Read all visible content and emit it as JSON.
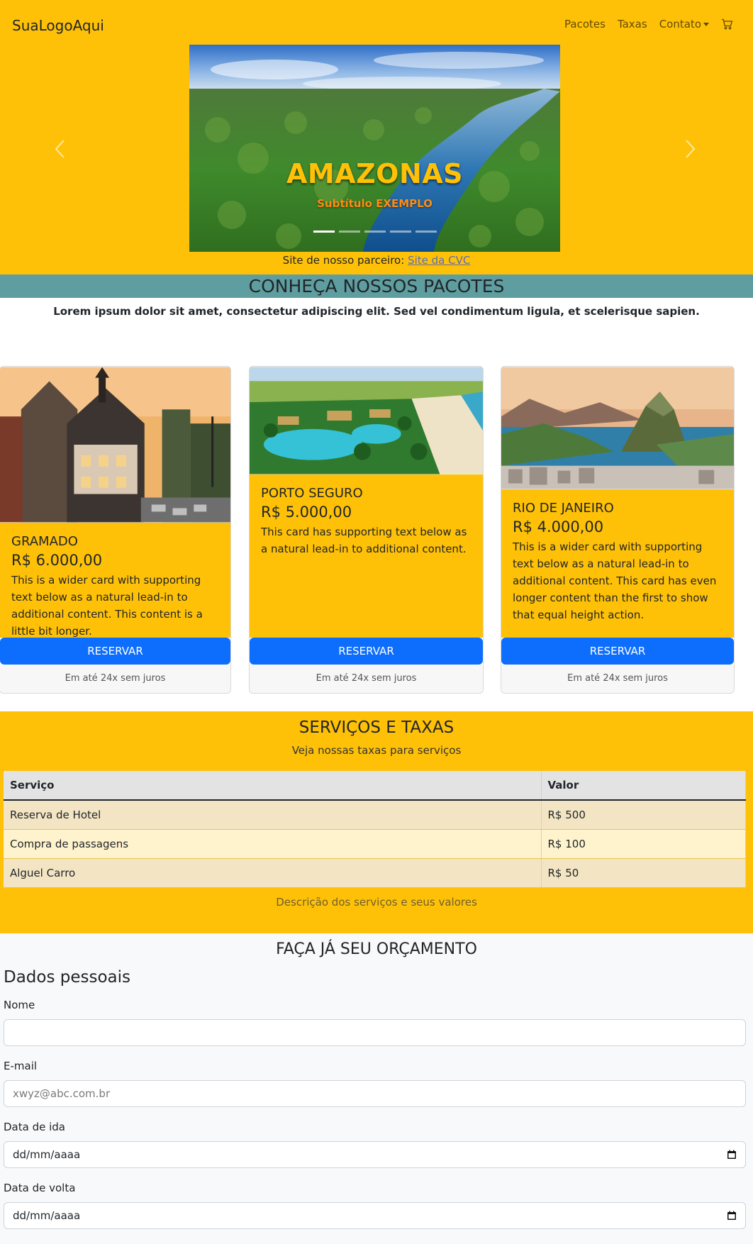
{
  "navbar": {
    "brand": "SuaLogoAqui",
    "links": [
      "Pacotes",
      "Taxas",
      "Contato"
    ],
    "cart_icon": "cart-icon"
  },
  "carousel": {
    "title": "AMAZONAS",
    "subtitle": "Subtítulo EXEMPLO",
    "indicator_count": 5,
    "active_index": 0,
    "prev_icon": "chevron-left-icon",
    "next_icon": "chevron-right-icon"
  },
  "partner": {
    "text": "Site de nosso parceiro: ",
    "link_label": "Site da CVC"
  },
  "packages": {
    "title": "CONHEÇA NOSSOS PACOTES",
    "lead": "Lorem ipsum dolor sit amet, consectetur adipiscing elit. Sed vel condimentum ligula, et scelerisque sapien.",
    "cards": [
      {
        "title": "GRAMADO",
        "price": "R$ 6.000,00",
        "text": "This is a wider card with supporting text below as a natural lead-in to additional content. This content is a little bit longer.",
        "button": "RESERVAR",
        "footer": "Em até 24x sem juros"
      },
      {
        "title": "PORTO SEGURO",
        "price": "R$ 5.000,00",
        "text": "This card has supporting text below as a natural lead-in to additional content.",
        "button": "RESERVAR",
        "footer": "Em até 24x sem juros"
      },
      {
        "title": "RIO DE JANEIRO",
        "price": "R$ 4.000,00",
        "text": "This is a wider card with supporting text below as a natural lead-in to additional content. This card has even longer content than the first to show that equal height action.",
        "button": "RESERVAR",
        "footer": "Em até 24x sem juros"
      }
    ]
  },
  "services": {
    "title": "SERVIÇOS E TAXAS",
    "subtitle": "Veja nossas taxas para serviços",
    "headers": [
      "Serviço",
      "Valor"
    ],
    "rows": [
      [
        "Reserva de Hotel",
        "R$ 500"
      ],
      [
        "Compra de passagens",
        "R$ 100"
      ],
      [
        "Alguel Carro",
        "R$ 50"
      ]
    ],
    "caption": "Descrição dos serviços e seus valores"
  },
  "quote": {
    "title": "FAÇA JÁ SEU ORÇAMENTO",
    "section": "Dados pessoais",
    "name_label": "Nome",
    "name_value": "",
    "email_label": "E-mail",
    "email_placeholder": "xwyz@abc.com.br",
    "depart_label": "Data de ida",
    "depart_value": "dd/mm/aaaa",
    "return_label": "Data de volta",
    "return_value": "dd/mm/aaaa",
    "calendar_icon": "calendar-icon"
  },
  "colors": {
    "accent": "#ffc107",
    "banner": "#5f9ea0",
    "primary_button": "#0d6efd"
  }
}
